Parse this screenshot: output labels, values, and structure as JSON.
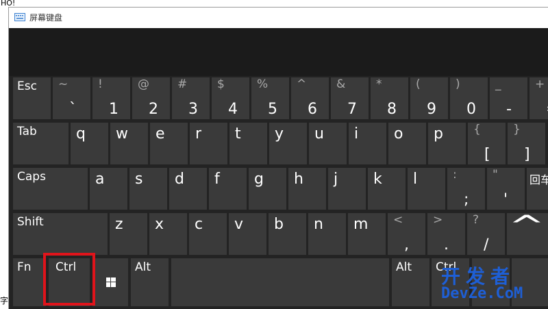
{
  "background": {
    "top_text": "HO!",
    "bottom_text": "字"
  },
  "window": {
    "title": "屏幕键盘"
  },
  "keys": {
    "esc": "Esc",
    "row1": [
      {
        "shift": "~",
        "main": "`"
      },
      {
        "shift": "!",
        "main": "1"
      },
      {
        "shift": "@",
        "main": "2"
      },
      {
        "shift": "#",
        "main": "3"
      },
      {
        "shift": "$",
        "main": "4"
      },
      {
        "shift": "%",
        "main": "5"
      },
      {
        "shift": "^",
        "main": "6"
      },
      {
        "shift": "&",
        "main": "7"
      },
      {
        "shift": "*",
        "main": "8"
      },
      {
        "shift": "(",
        "main": "9"
      },
      {
        "shift": ")",
        "main": "0"
      },
      {
        "shift": "_",
        "main": "-"
      },
      {
        "shift": "+",
        "main": "="
      }
    ],
    "tab": "Tab",
    "row2": [
      "q",
      "w",
      "e",
      "r",
      "t",
      "y",
      "u",
      "i",
      "o",
      "p"
    ],
    "row2_brackets": [
      {
        "shift": "{",
        "main": "["
      },
      {
        "shift": "}",
        "main": "]"
      }
    ],
    "caps": "Caps",
    "row3": [
      "a",
      "s",
      "d",
      "f",
      "g",
      "h",
      "j",
      "k",
      "l"
    ],
    "row3_punct": [
      {
        "shift": ":",
        "main": ";"
      },
      {
        "shift": "\"",
        "main": "'"
      }
    ],
    "enter": "回车",
    "shift": "Shift",
    "row4": [
      "z",
      "x",
      "c",
      "v",
      "b",
      "n",
      "m"
    ],
    "row4_punct": [
      {
        "shift": "<",
        "main": ","
      },
      {
        "shift": ">",
        "main": "."
      },
      {
        "shift": "?",
        "main": "/"
      }
    ],
    "up_arrow": "^",
    "fn": "Fn",
    "ctrl_left": "Ctrl",
    "alt_left": "Alt",
    "alt_right": "Alt",
    "ctrl_right": "Ctrl"
  },
  "watermark": {
    "cn": "开发者",
    "en": "DevZe.CoM"
  },
  "colors": {
    "key": "#3a3a3a",
    "keyboard_bg": "#232323",
    "highlight": "#e0141b",
    "watermark": "#1e5fd6"
  }
}
